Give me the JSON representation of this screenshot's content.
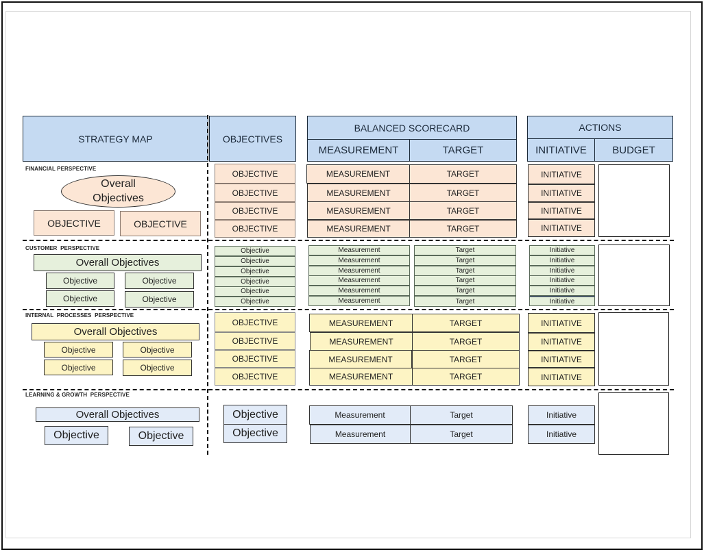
{
  "headers": {
    "strategy_map": "STRATEGY MAP",
    "objectives": "OBJECTIVES",
    "balanced_scorecard": "BALANCED SCORECARD",
    "measurement": "MEASUREMENT",
    "target": "TARGET",
    "actions": "ACTIONS",
    "initiative": "INITIATIVE",
    "budget": "BUDGET"
  },
  "colors": {
    "header": "#c5daf2",
    "financial": "#fce6d5",
    "customer": "#e6f0dc",
    "internal": "#fdf4c4",
    "learning": "#e2ebf8"
  },
  "perspectives": [
    {
      "title": "FINANCIAL PERSPECTIVE",
      "overall": "Overall Objectives",
      "map_objectives": [
        "OBJECTIVE",
        "OBJECTIVE"
      ],
      "objectives": [
        "OBJECTIVE",
        "OBJECTIVE",
        "OBJECTIVE",
        "OBJECTIVE"
      ],
      "measurements": [
        "MEASUREMENT",
        "MEASUREMENT",
        "MEASUREMENT",
        "MEASUREMENT"
      ],
      "targets": [
        "TARGET",
        "TARGET",
        "TARGET",
        "TARGET"
      ],
      "initiatives": [
        "INITIATIVE",
        "INITIATIVE",
        "INITIATIVE",
        "INITIATIVE"
      ]
    },
    {
      "title": "CUSTOMER  PERSPECTIVE",
      "overall": "Overall Objectives",
      "map_objectives": [
        "Objective",
        "Objective",
        "Objective",
        "Objective"
      ],
      "objectives": [
        "Objective",
        "Objective",
        "Objective",
        "Objective",
        "Objective",
        "Objective"
      ],
      "measurements": [
        "Measurement",
        "Measurement",
        "Measurement",
        "Measurement",
        "Measurement",
        "Measurement"
      ],
      "targets": [
        "Target",
        "Target",
        "Target",
        "Target",
        "Target",
        "Target"
      ],
      "initiatives": [
        "Initiative",
        "Initiative",
        "Initiative",
        "Initiative",
        "Initiative",
        "Initiative"
      ]
    },
    {
      "title": "INTERNAL  PROCESSES  PERSPECTIVE",
      "overall": "Overall Objectives",
      "map_objectives": [
        "Objective",
        "Objective",
        "Objective",
        "Objective"
      ],
      "objectives": [
        "OBJECTIVE",
        "OBJECTIVE",
        "OBJECTIVE",
        "OBJECTIVE"
      ],
      "measurements": [
        "MEASUREMENT",
        "MEASUREMENT",
        "MEASUREMENT",
        "MEASUREMENT"
      ],
      "targets": [
        "TARGET",
        "TARGET",
        "TARGET",
        "TARGET"
      ],
      "initiatives": [
        "INITIATIVE",
        "INITIATIVE",
        "INITIATIVE",
        "INITIATIVE"
      ]
    },
    {
      "title": "LEARNING & GROWTH  PERSPECTIVE",
      "overall": "Overall Objectives",
      "map_objectives": [
        "Objective",
        "Objective"
      ],
      "objectives": [
        "Objective",
        "Objective"
      ],
      "measurements": [
        "Measurement",
        "Measurement"
      ],
      "targets": [
        "Target",
        "Target"
      ],
      "initiatives": [
        "Initiative",
        "Initiative"
      ]
    }
  ]
}
